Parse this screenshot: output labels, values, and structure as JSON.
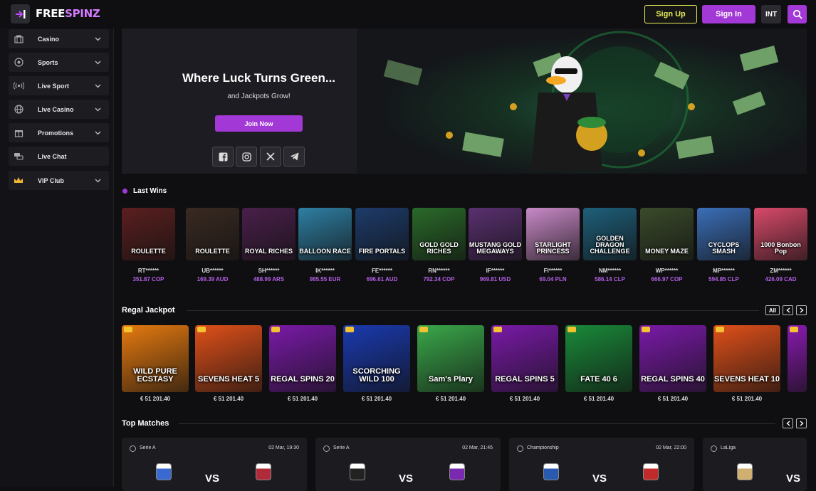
{
  "brand": {
    "name_a": "FREE",
    "name_b": "SPINZ"
  },
  "header": {
    "sign_up": "Sign Up",
    "sign_in": "Sign In",
    "region": "INT"
  },
  "sidebar": {
    "items": [
      {
        "label": "Casino",
        "icon": "casino-icon",
        "has_chevron": true
      },
      {
        "label": "Sports",
        "icon": "soccer-ball-icon",
        "has_chevron": true
      },
      {
        "label": "Live Sport",
        "icon": "broadcast-icon",
        "has_chevron": true
      },
      {
        "label": "Live Casino",
        "icon": "globe-icon",
        "has_chevron": true
      },
      {
        "label": "Promotions",
        "icon": "gift-icon",
        "has_chevron": true
      },
      {
        "label": "Live Chat",
        "icon": "chat-icon",
        "has_chevron": false
      },
      {
        "label": "VIP Club",
        "icon": "crown-icon",
        "has_chevron": true
      }
    ]
  },
  "hero": {
    "title": "Where Luck Turns Green...",
    "subtitle": "and Jackpots Grow!",
    "cta": "Join Now",
    "socials": [
      "facebook-icon",
      "instagram-icon",
      "x-icon",
      "telegram-icon"
    ]
  },
  "last_wins": {
    "title": "Last Wins",
    "items": [
      {
        "game": "ROULETTE",
        "user": "RT******",
        "amount": "351.87 COP",
        "color": "#5b1f1f"
      },
      {
        "game": "ROULETTE",
        "user": "UB******",
        "amount": "169.39 AUD",
        "color": "#3a2a22"
      },
      {
        "game": "ROYAL RICHES",
        "user": "SH******",
        "amount": "488.99 ARS",
        "color": "#4a1f4a"
      },
      {
        "game": "BALLOON RACE",
        "user": "IK******",
        "amount": "985.55 EUR",
        "color": "#2e7fa3"
      },
      {
        "game": "FIRE PORTALS",
        "user": "FE******",
        "amount": "696.61 AUD",
        "color": "#1d3b6a"
      },
      {
        "game": "GOLD GOLD RICHES",
        "user": "RN******",
        "amount": "792.34 COP",
        "color": "#2a6a2a"
      },
      {
        "game": "MUSTANG GOLD MEGAWAYS",
        "user": "IF******",
        "amount": "969.81 USD",
        "color": "#5a3070"
      },
      {
        "game": "STARLIGHT PRINCESS",
        "user": "FI******",
        "amount": "69.04 PLN",
        "color": "#c98ac8"
      },
      {
        "game": "GOLDEN DRAGON CHALLENGE",
        "user": "NM******",
        "amount": "586.14 CLP",
        "color": "#1e5f7a"
      },
      {
        "game": "MONEY MAZE",
        "user": "WP******",
        "amount": "666.97 COP",
        "color": "#3a4a2a"
      },
      {
        "game": "CYCLOPS SMASH",
        "user": "MP******",
        "amount": "594.85 CLP",
        "color": "#3b6fb8"
      },
      {
        "game": "1000 Bonbon Pop",
        "user": "ZM******",
        "amount": "426.09 CAD",
        "color": "#d84a6a"
      }
    ]
  },
  "regal_jackpot": {
    "title": "Regal Jackpot",
    "all_label": "All",
    "items": [
      {
        "game": "WILD PURE ECSTASY",
        "amount": "€ 51 201.40",
        "color": "#e67a10"
      },
      {
        "game": "SEVENS HEAT 5",
        "amount": "€ 51 201.40",
        "color": "#e0501a"
      },
      {
        "game": "REGAL SPINS 20",
        "amount": "€ 51 201.40",
        "color": "#7a1aa8"
      },
      {
        "game": "SCORCHING WILD 100",
        "amount": "€ 51 201.40",
        "color": "#1a3ab0"
      },
      {
        "game": "Sam's Plary",
        "amount": "€ 51 201.40",
        "color": "#3aa84a"
      },
      {
        "game": "REGAL SPINS 5",
        "amount": "€ 51 201.40",
        "color": "#7a1aa8"
      },
      {
        "game": "FATE 40 6",
        "amount": "€ 51 201.40",
        "color": "#1a8a3a"
      },
      {
        "game": "REGAL SPINS 40",
        "amount": "€ 51 201.40",
        "color": "#7a1aa8"
      },
      {
        "game": "SEVENS HEAT 10",
        "amount": "€ 51 201.40",
        "color": "#e0501a"
      },
      {
        "game": "",
        "amount": "",
        "color": "#8a1ab0"
      }
    ]
  },
  "top_matches": {
    "title": "Top Matches",
    "items": [
      {
        "league": "Serie A",
        "date": "02 Mar, 19:30",
        "vs": "VS",
        "home_color": "#3a6ad0",
        "away_color": "#b02a3a"
      },
      {
        "league": "Serie A",
        "date": "02 Mar, 21:45",
        "vs": "VS",
        "home_color": "#222222",
        "away_color": "#7a2ab0"
      },
      {
        "league": "Championship",
        "date": "02 Mar, 22:00",
        "vs": "VS",
        "home_color": "#2a5ab0",
        "away_color": "#c02a2a"
      },
      {
        "league": "LaLiga",
        "date": "",
        "vs": "VS",
        "home_color": "#d0b070",
        "away_color": "#000000"
      }
    ]
  }
}
